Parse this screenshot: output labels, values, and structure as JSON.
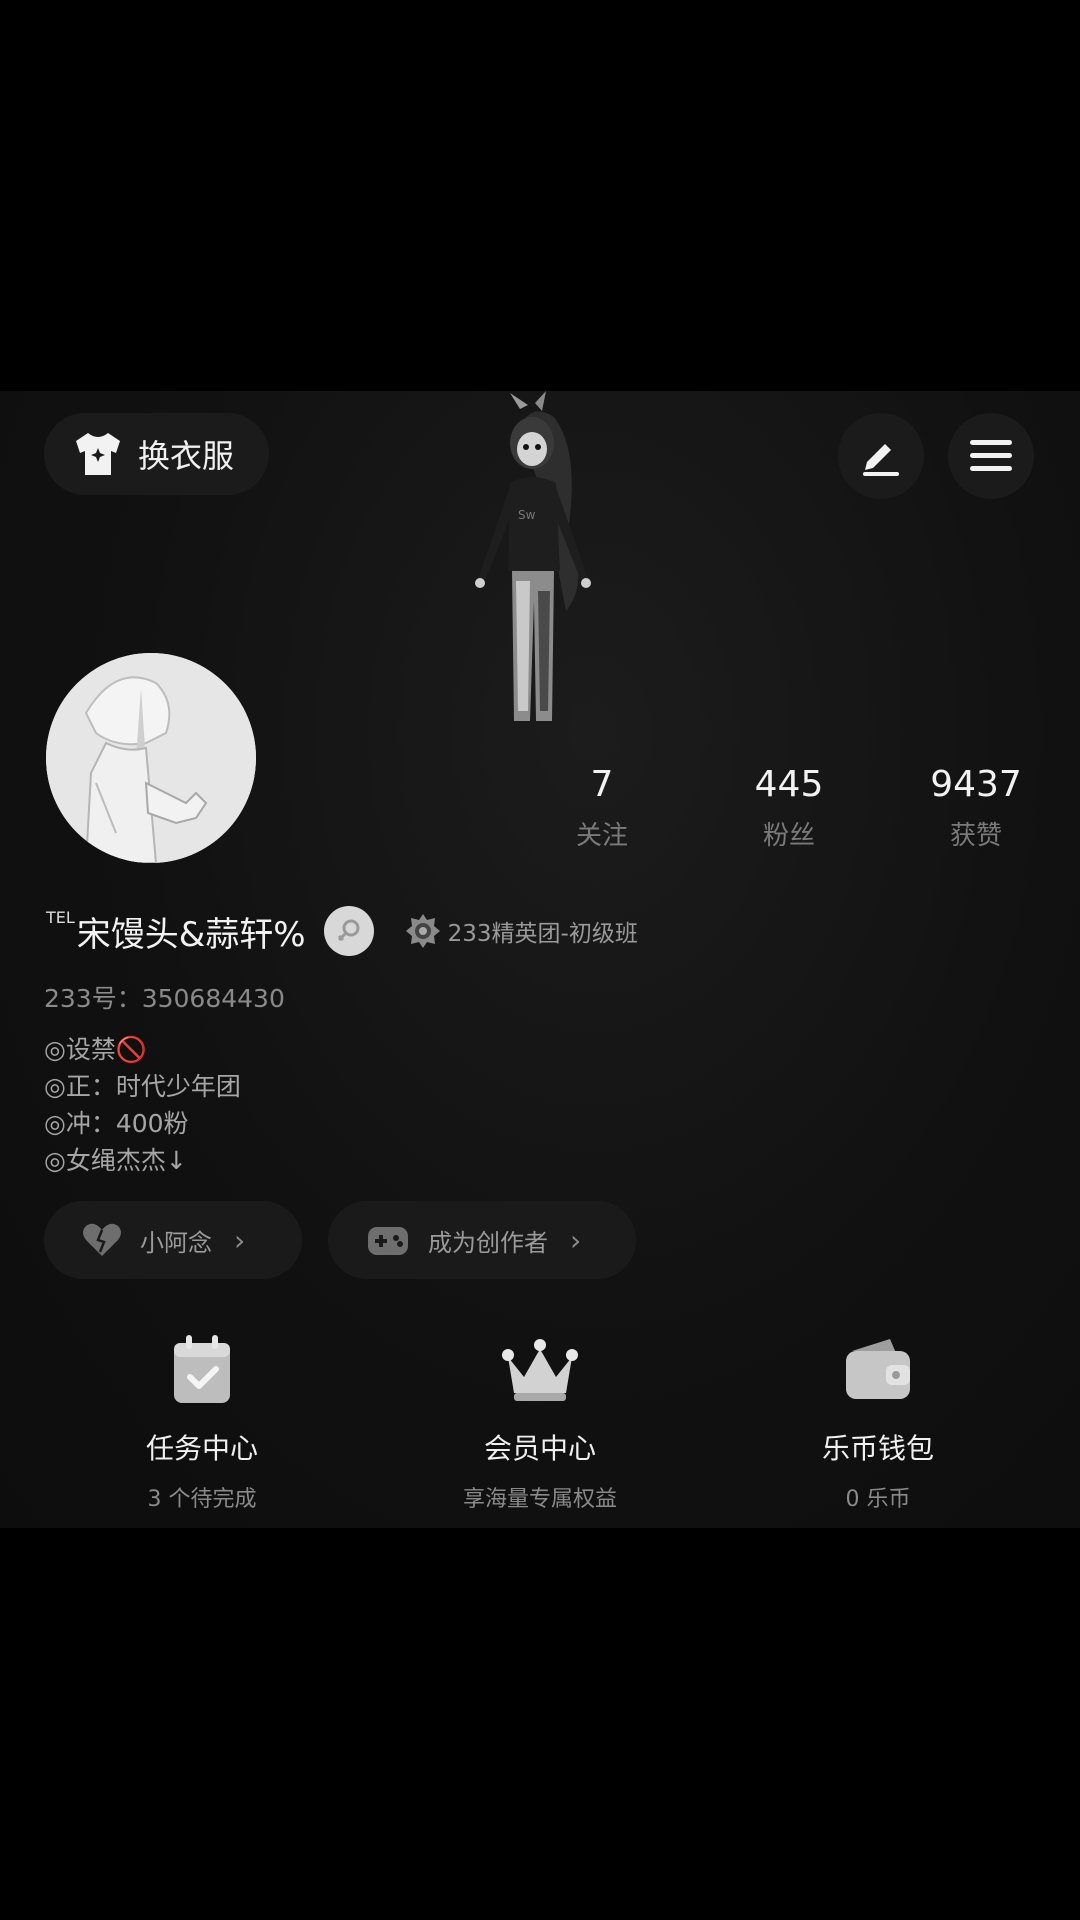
{
  "header": {
    "outfit_label": "换衣服",
    "edit_icon": "pencil-icon",
    "menu_icon": "hamburger-menu-icon"
  },
  "profile": {
    "name_prefix": "TEL",
    "name": "宋馒头&蒜轩%",
    "gender_icon": "female-icon",
    "rank_label": "233精英团-初级班",
    "uid": "233号：350684430"
  },
  "stats": [
    {
      "value": "7",
      "label": "关注"
    },
    {
      "value": "445",
      "label": "粉丝"
    },
    {
      "value": "9437",
      "label": "获赞"
    }
  ],
  "bio": [
    "◎设禁🚫",
    "◎正：时代少年团",
    "◎冲：400粉",
    "◎女绳杰杰↓"
  ],
  "chips": {
    "love_label": "小阿念",
    "creator_label": "成为创作者",
    "chevron": "›"
  },
  "features": [
    {
      "title": "任务中心",
      "sub": "3 个待完成"
    },
    {
      "title": "会员中心",
      "sub": "享海量专属权益"
    },
    {
      "title": "乐币钱包",
      "sub": "0 乐币"
    }
  ]
}
